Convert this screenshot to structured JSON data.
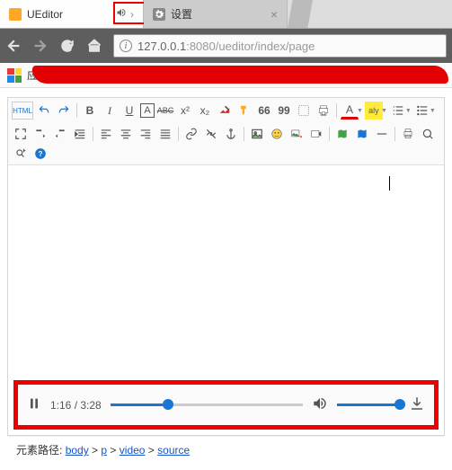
{
  "browser": {
    "tabs": [
      {
        "title": "UEditor",
        "has_audio": true
      },
      {
        "title": "设置"
      }
    ],
    "url": {
      "host": "127.0.0.1",
      "port": ":8080",
      "path": "/ueditor/index/page"
    },
    "bookmark_apps_label": "应"
  },
  "toolbar": {
    "html_label": "HTML",
    "bold": "B",
    "italic": "I",
    "underline": "U",
    "font_bg": "A",
    "strike": "ABC",
    "super": "x²",
    "sub": "x₂",
    "quote66": "66",
    "quote99": "99",
    "font_letter": "A",
    "hl_letter": "aly"
  },
  "player": {
    "current_time": "1:16",
    "total_time": "3:28",
    "time_display": "1:16 / 3:28",
    "progress_percent": 30,
    "volume_percent": 100
  },
  "path": {
    "label": "元素路径:",
    "crumbs": [
      "body",
      "p",
      "video",
      "source"
    ]
  }
}
